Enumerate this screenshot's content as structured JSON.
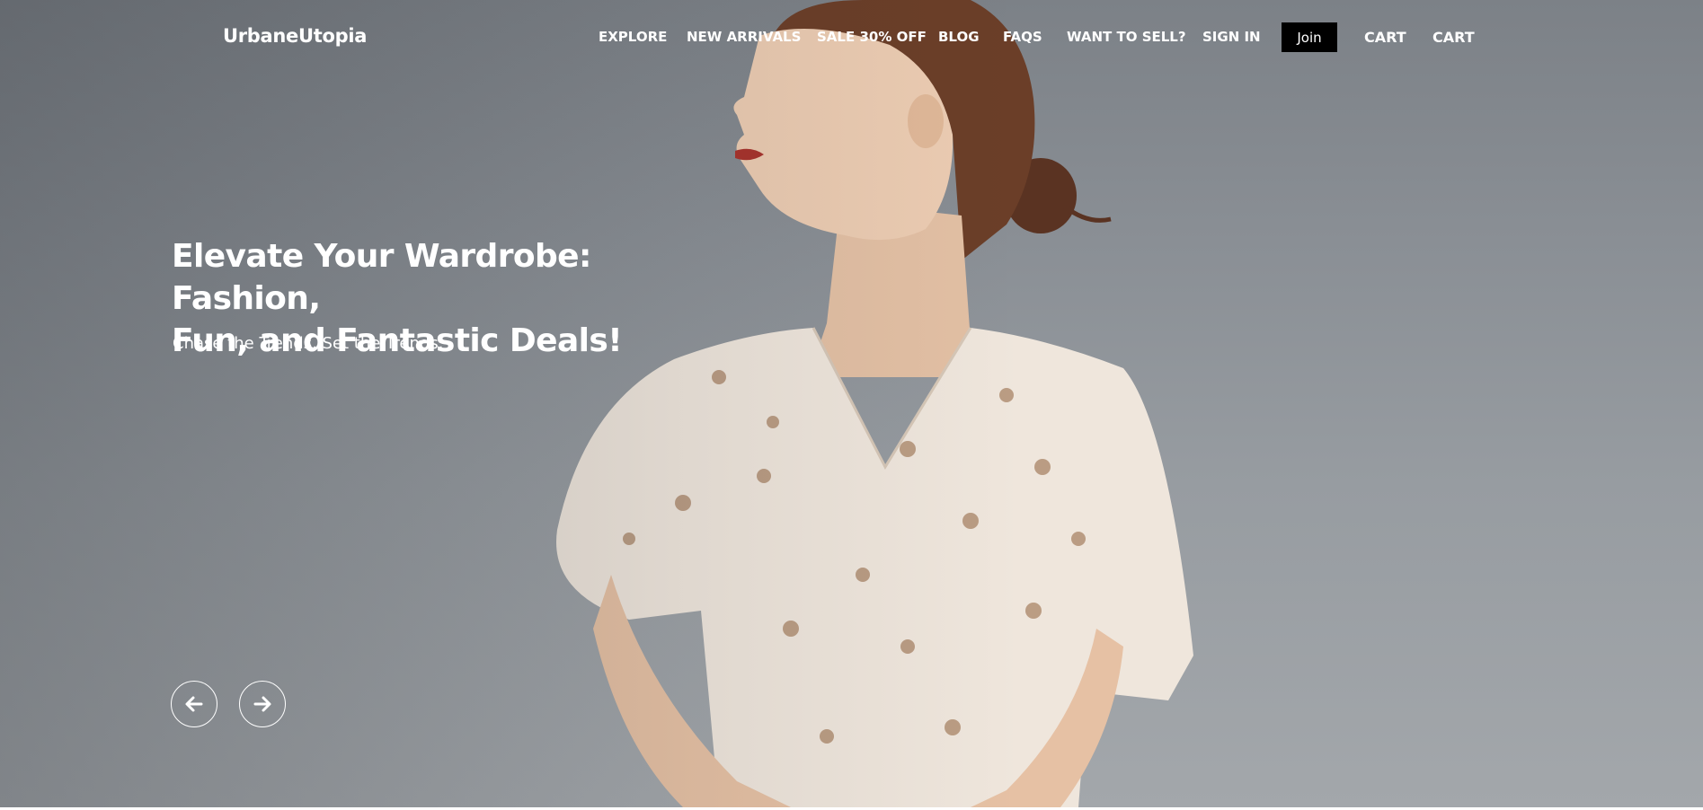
{
  "header": {
    "brand": "UrbaneUtopia",
    "nav": [
      {
        "label": "EXPLORE"
      },
      {
        "label": "NEW ARRIVALS"
      },
      {
        "label": "SALE 30% OFF"
      },
      {
        "label": "BLOG"
      },
      {
        "label": "FAQS"
      },
      {
        "label": "WANT TO SELL?"
      },
      {
        "label": "SIGN IN"
      }
    ],
    "join_label": "Join",
    "cart_labels": [
      "CART",
      "CART"
    ]
  },
  "hero": {
    "headline_line1": "Elevate Your Wardrobe: Fashion,",
    "headline_line2": "Fun, and Fantastic Deals!",
    "subheadline": "Chase the Trends, Set the Trends.",
    "prev_icon": "arrow-left-icon",
    "next_icon": "arrow-right-icon"
  },
  "colors": {
    "sky": "#8a8f95",
    "text": "#ffffff",
    "join_bg": "#000000"
  }
}
